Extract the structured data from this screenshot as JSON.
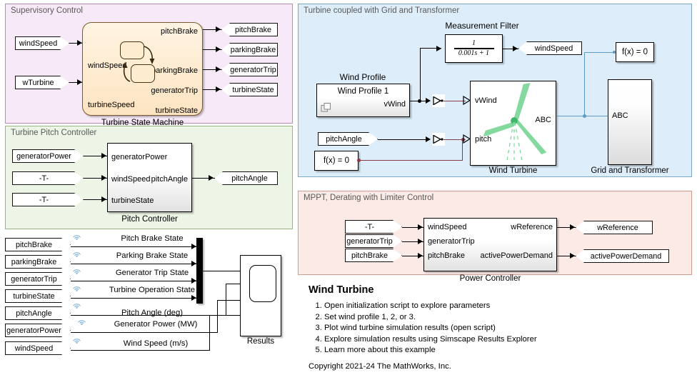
{
  "panels": {
    "supervisory": {
      "title": "Supervisory Control",
      "color": "#f7e9f7"
    },
    "pitch": {
      "title": "Turbine Pitch Controller",
      "color": "#edf5e6"
    },
    "turbine_grid": {
      "title": "Turbine coupled with Grid and Transformer",
      "color": "#ddeefa"
    },
    "mppt": {
      "title": "MPPT, Derating with Limiter Control",
      "color": "#fbeae6"
    }
  },
  "supervisory": {
    "inputs": [
      {
        "label": "windSpeed"
      },
      {
        "label": "wTurbine"
      }
    ],
    "chart": {
      "name": "Turbine State Machine",
      "in_ports": [
        "windSpeed",
        "turbineSpeed"
      ],
      "out_ports": [
        "pitchBrake",
        "parkingBrake",
        "generatorTrip",
        "turbineState"
      ]
    },
    "outputs": [
      {
        "label": "pitchBrake"
      },
      {
        "label": "parkingBrake"
      },
      {
        "label": "generatorTrip"
      },
      {
        "label": "turbineState"
      }
    ]
  },
  "pitch_controller": {
    "inputs": [
      {
        "label": "generatorPower"
      },
      {
        "label": "-T-"
      },
      {
        "label": "-T-"
      }
    ],
    "block": {
      "name": "Pitch Controller",
      "in_ports": [
        "generatorPower",
        "windSpeed",
        "turbineState"
      ],
      "out_ports": [
        "pitchAngle"
      ]
    },
    "outputs": [
      {
        "label": "pitchAngle"
      }
    ]
  },
  "logging": {
    "sources": [
      {
        "tag": "pitchBrake",
        "signal": "Pitch Brake State"
      },
      {
        "tag": "parkingBrake",
        "signal": "Parking Brake State"
      },
      {
        "tag": "generatorTrip",
        "signal": "Generator Trip State"
      },
      {
        "tag": "turbineState",
        "signal": "Turbine Operation State"
      },
      {
        "tag": "pitchAngle",
        "signal": "Pitch Angle (deg)"
      },
      {
        "tag": "generatorPower",
        "signal": "Generator Power (MW)"
      },
      {
        "tag": "windSpeed",
        "signal": "Wind Speed (m/s)"
      }
    ],
    "scope_label": "Results",
    "mux_name": "mux"
  },
  "turbine_grid": {
    "measurement_filter": {
      "title": "Measurement Filter",
      "numerator": "1",
      "denominator": "0.001s + 1"
    },
    "windspeed_tag": "windSpeed",
    "wind_profile": {
      "title": "Wind Profile",
      "block_label": "Wind Profile 1",
      "out_port": "vWind"
    },
    "pitch_tag": "pitchAngle",
    "fx_left": "f(x) = 0",
    "fx_right": "f(x) = 0",
    "wind_turbine": {
      "name": "Wind Turbine",
      "in_ports": [
        "vWind",
        "pitch"
      ],
      "out_ports": [
        "ABC"
      ],
      "blade_color": "#7ed79a"
    },
    "grid": {
      "name": "Grid and Transformer",
      "in_ports": [
        "ABC"
      ]
    }
  },
  "mppt": {
    "inputs": [
      {
        "label": "-T-"
      },
      {
        "label": "generatorTrip"
      },
      {
        "label": "pitchBrake"
      }
    ],
    "block": {
      "name": "Power Controller",
      "in_ports": [
        "windSpeed",
        "generatorTrip",
        "pitchBrake"
      ],
      "out_ports": [
        "wReference",
        "activePowerDemand"
      ]
    },
    "outputs": [
      {
        "label": "wReference"
      },
      {
        "label": "activePowerDemand"
      }
    ]
  },
  "doc": {
    "title": "Wind Turbine",
    "steps": [
      "Open initialization script to explore parameters",
      "Set wind profile 1, 2, or 3.",
      "Plot wind turbine simulation results (open script)",
      "Explore simulation results using Simscape Results Explorer",
      "Learn more about this example"
    ],
    "copyright": "Copyright 2021-24 The MathWorks, Inc."
  },
  "colors": {
    "physical_line": "#5d9bc7",
    "ps_line": "#8a3c46",
    "signal_line": "#000000",
    "broadcast_icon": "#7fb2dc"
  }
}
